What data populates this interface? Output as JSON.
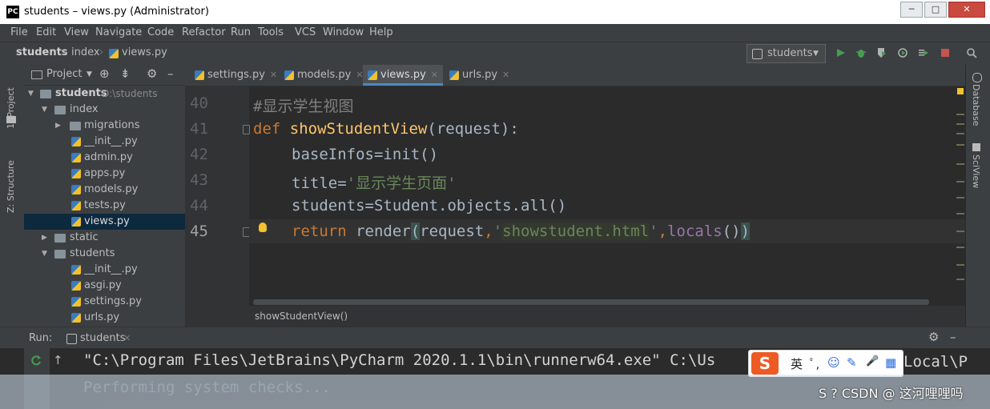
{
  "window": {
    "app_icon_text": "PC",
    "title": "students – views.py (Administrator)",
    "buttons": [
      "─",
      "□",
      "✕"
    ]
  },
  "menu": [
    "File",
    "Edit",
    "View",
    "Navigate",
    "Code",
    "Refactor",
    "Run",
    "Tools",
    "VCS",
    "Window",
    "Help"
  ],
  "navbar": {
    "crumbs": [
      "students",
      "index",
      "views.py"
    ],
    "run_config": "students",
    "toolbar_icons": [
      "run-icon",
      "debug-icon",
      "coverage-icon",
      "profile-icon",
      "concurrency-icon",
      "stop-icon",
      "search-icon"
    ]
  },
  "left_strip": {
    "project_tab": "1: Project",
    "structure_tab": "Z: Structure"
  },
  "right_strip": {
    "database_tab": "Database",
    "sciview_tab": "SciView"
  },
  "project_panel": {
    "header": "Project",
    "tree": [
      {
        "label": "students",
        "suffix": "D:\\students",
        "type": "folder",
        "indent": 0,
        "expanded": true,
        "bold": true
      },
      {
        "label": "index",
        "type": "folder",
        "indent": 1,
        "expanded": true
      },
      {
        "label": "migrations",
        "type": "folder",
        "indent": 2,
        "expanded": false
      },
      {
        "label": "__init__.py",
        "type": "py",
        "indent": 2
      },
      {
        "label": "admin.py",
        "type": "py",
        "indent": 2
      },
      {
        "label": "apps.py",
        "type": "py",
        "indent": 2
      },
      {
        "label": "models.py",
        "type": "py",
        "indent": 2
      },
      {
        "label": "tests.py",
        "type": "py",
        "indent": 2
      },
      {
        "label": "views.py",
        "type": "py",
        "indent": 2,
        "selected": true
      },
      {
        "label": "static",
        "type": "folder",
        "indent": 1,
        "expanded": false
      },
      {
        "label": "students",
        "type": "folder",
        "indent": 1,
        "expanded": true
      },
      {
        "label": "__init__.py",
        "type": "py",
        "indent": 2
      },
      {
        "label": "asgi.py",
        "type": "py",
        "indent": 2
      },
      {
        "label": "settings.py",
        "type": "py",
        "indent": 2
      },
      {
        "label": "urls.py",
        "type": "py",
        "indent": 2
      }
    ]
  },
  "tabs": [
    {
      "label": "settings.py",
      "active": false
    },
    {
      "label": "models.py",
      "active": false
    },
    {
      "label": "views.py",
      "active": true
    },
    {
      "label": "urls.py",
      "active": false
    }
  ],
  "editor": {
    "line_numbers": [
      "40",
      "41",
      "42",
      "43",
      "44",
      "45"
    ],
    "current_line": "45",
    "lines": {
      "l40_comment": "#显示学生视图",
      "l41_def": "def",
      "l41_name": "showStudentView",
      "l41_rest": "(request):",
      "l42": "baseInfos=init()",
      "l43_a": "title=",
      "l43_str": "'显示学生页面'",
      "l44": "students=Student.objects.all()",
      "l45_return": "return",
      "l45_call": " render",
      "l45_p1": "(",
      "l45_arg1": "request",
      "l45_comma1": ",",
      "l45_q1": "'",
      "l45_str": "showstudent.html",
      "l45_q2": "'",
      "l45_comma2": ",",
      "l45_locals": "locals",
      "l45_p2": "()",
      "l45_p3": ")"
    },
    "breadcrumb": "showStudentView()"
  },
  "run_panel": {
    "label": "Run:",
    "config_tab": "students",
    "console": [
      "\"C:\\Program Files\\JetBrains\\PyCharm 2020.1.1\\bin\\runnerw64.exe\" C:\\Us",
      "Performing system checks..."
    ],
    "console_tail": "Local\\P"
  },
  "ime": {
    "logo": "S",
    "lang": "英",
    "items": [
      "ﾟ,",
      "☺",
      "✎",
      "🎤",
      "▦"
    ]
  },
  "watermark": "S ? CSDN @ 这河哩哩吗"
}
